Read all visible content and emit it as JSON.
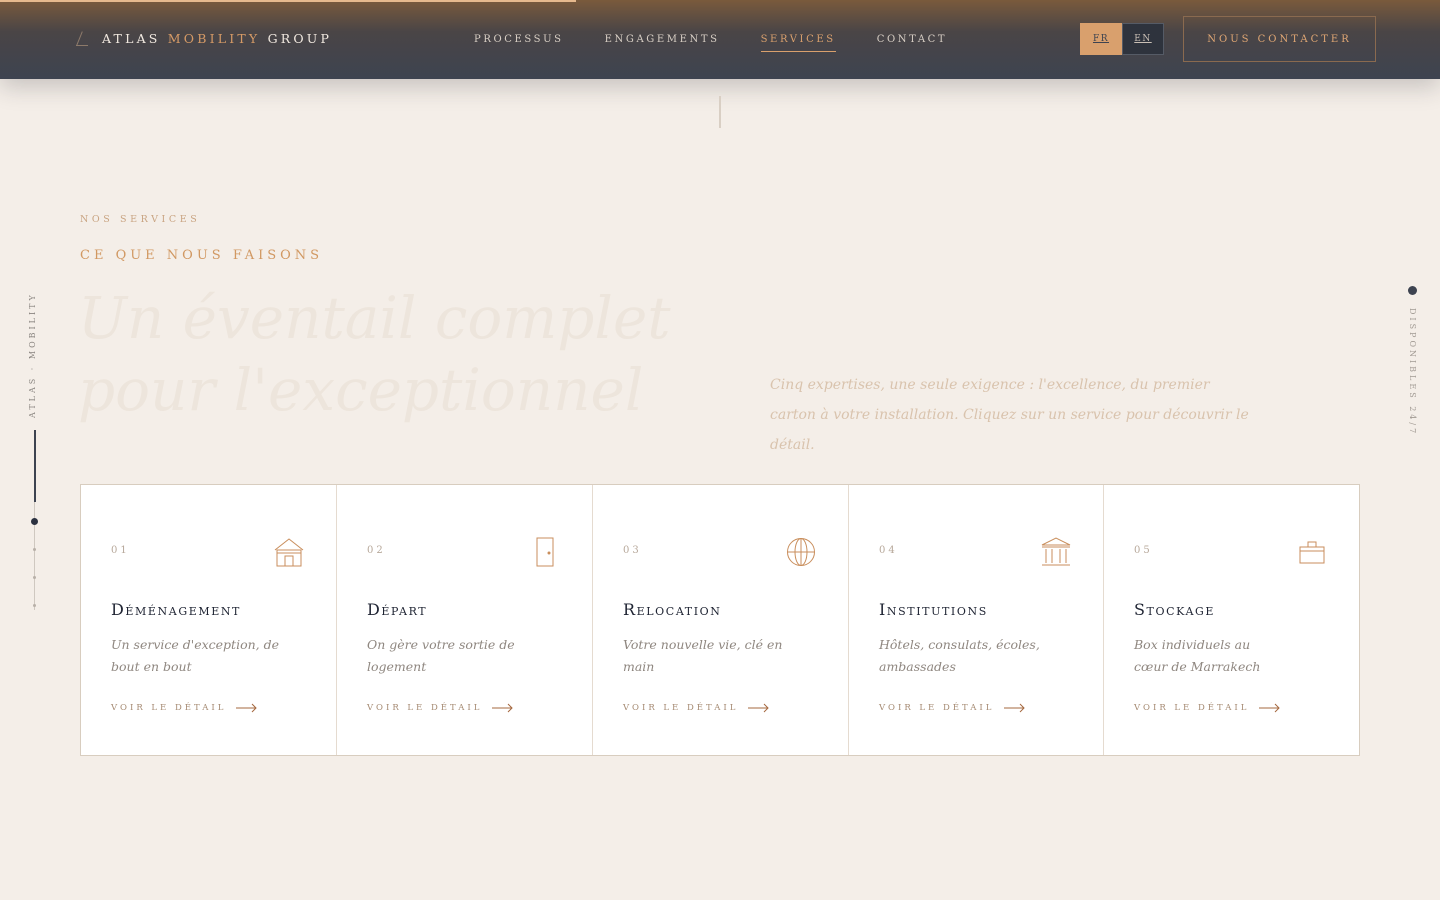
{
  "brand": {
    "name_part1": "ATLAS",
    "name_part2": "MOBILITY",
    "name_part3": "GROUP"
  },
  "nav": {
    "items": [
      {
        "label": "Processus",
        "active": false
      },
      {
        "label": "Engagements",
        "active": false
      },
      {
        "label": "Services",
        "active": true
      },
      {
        "label": "Contact",
        "active": false
      }
    ]
  },
  "lang": {
    "fr": "FR",
    "en": "EN",
    "selected": "FR"
  },
  "header": {
    "cta_label": "NOUS CONTACTER"
  },
  "page_scroll_progress": 0.4,
  "rails": {
    "left_text": "ATLAS · MOBILITY",
    "right_text": "DISPONIBLES 24/7"
  },
  "intro": {
    "eyebrow": "NOS SERVICES",
    "subtitle": "CE QUE NOUS FAISONS",
    "title_line1": "Un éventail complet",
    "title_line2": "pour l'exceptionnel",
    "lead": "Cinq expertises, une seule exigence : l'excellence, du premier carton à votre installation. Cliquez sur un service pour découvrir le détail."
  },
  "services": [
    {
      "num": "01",
      "title": "Déménagement",
      "desc": "Un service d'exception, de bout en bout",
      "more": "VOIR LE DÉTAIL",
      "icon": "house-icon"
    },
    {
      "num": "02",
      "title": "Départ",
      "desc": "On gère votre sortie de logement",
      "more": "VOIR LE DÉTAIL",
      "icon": "door-icon"
    },
    {
      "num": "03",
      "title": "Relocation",
      "desc": "Votre nouvelle vie, clé en main",
      "more": "VOIR LE DÉTAIL",
      "icon": "globe-icon"
    },
    {
      "num": "04",
      "title": "Institutions",
      "desc": "Hôtels, consulats, écoles, ambassades",
      "more": "VOIR LE DÉTAIL",
      "icon": "building-icon"
    },
    {
      "num": "05",
      "title": "Stockage",
      "desc": "Box individuels au cœur de Marrakech",
      "more": "VOIR LE DÉTAIL",
      "icon": "storage-box-icon"
    }
  ],
  "colors": {
    "accent": "#d9a06d",
    "navy": "#3d4350",
    "bg": "#f4eee8"
  }
}
